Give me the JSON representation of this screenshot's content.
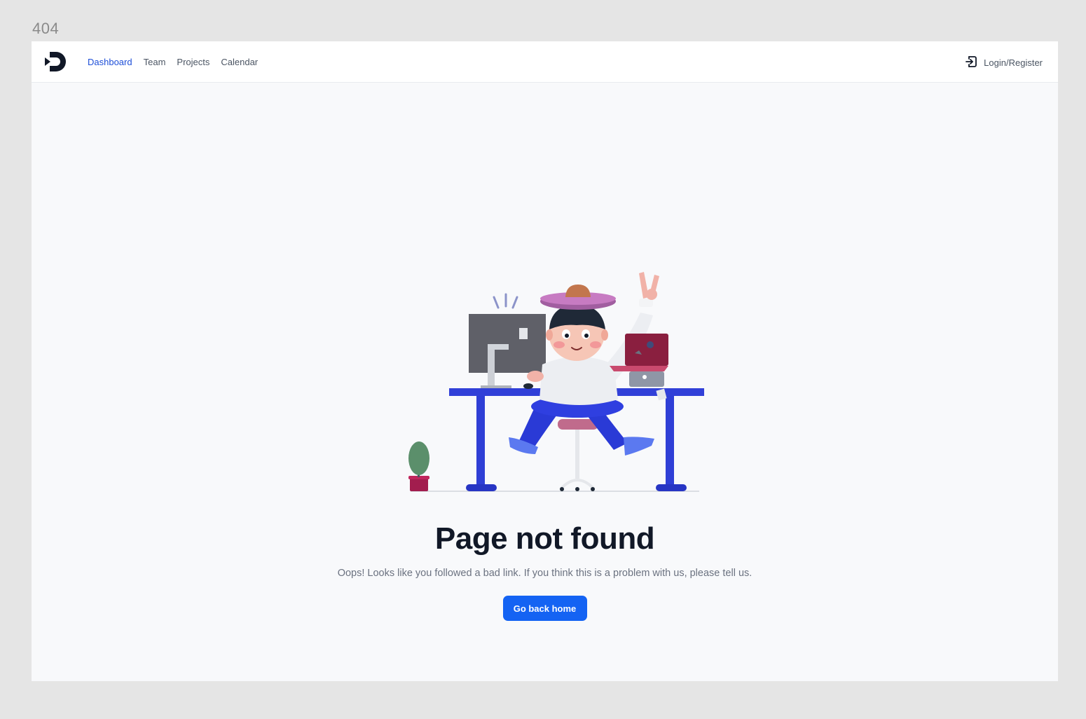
{
  "frame": {
    "label": "404"
  },
  "navbar": {
    "logo_icon": "d-logo-icon",
    "links": [
      {
        "label": "Dashboard",
        "active": true
      },
      {
        "label": "Team",
        "active": false
      },
      {
        "label": "Projects",
        "active": false
      },
      {
        "label": "Calendar",
        "active": false
      }
    ],
    "login": {
      "label": "Login/Register",
      "icon": "login-icon"
    }
  },
  "content": {
    "illustration": "person-at-desk-illustration",
    "title": "Page not found",
    "message": "Oops! Looks like you followed a bad link. If you think this is a problem with us, please tell us.",
    "cta_label": "Go back home"
  },
  "colors": {
    "accent": "#1463f3",
    "active_link": "#1d4ed8",
    "title": "#111827",
    "text_muted": "#6b7280",
    "background": "#f8f9fb",
    "desk": "#2f3fd6"
  }
}
